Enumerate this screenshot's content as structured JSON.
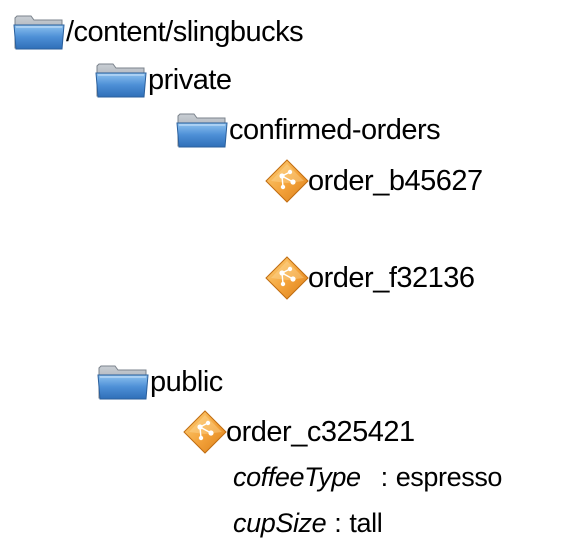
{
  "tree": {
    "root": {
      "label": "/content/slingbucks",
      "icon": "folder-icon"
    },
    "private": {
      "label": "private",
      "icon": "folder-icon"
    },
    "confirmed_orders": {
      "label": "confirmed-orders",
      "icon": "folder-icon"
    },
    "order_b": {
      "label": "order_b45627",
      "icon": "node-icon"
    },
    "order_f": {
      "label": "order_f32136",
      "icon": "node-icon"
    },
    "public": {
      "label": "public",
      "icon": "folder-icon"
    },
    "order_c": {
      "label": "order_c325421",
      "icon": "node-icon",
      "properties": [
        {
          "name": "coffeeType",
          "separator": ":",
          "value": "espresso"
        },
        {
          "name": "cupSize",
          "separator": ":",
          "value": "tall"
        }
      ]
    }
  },
  "colors": {
    "folder_blue": "#4a86c8",
    "folder_gray": "#9aa3ad",
    "node_orange": "#f0a030"
  }
}
